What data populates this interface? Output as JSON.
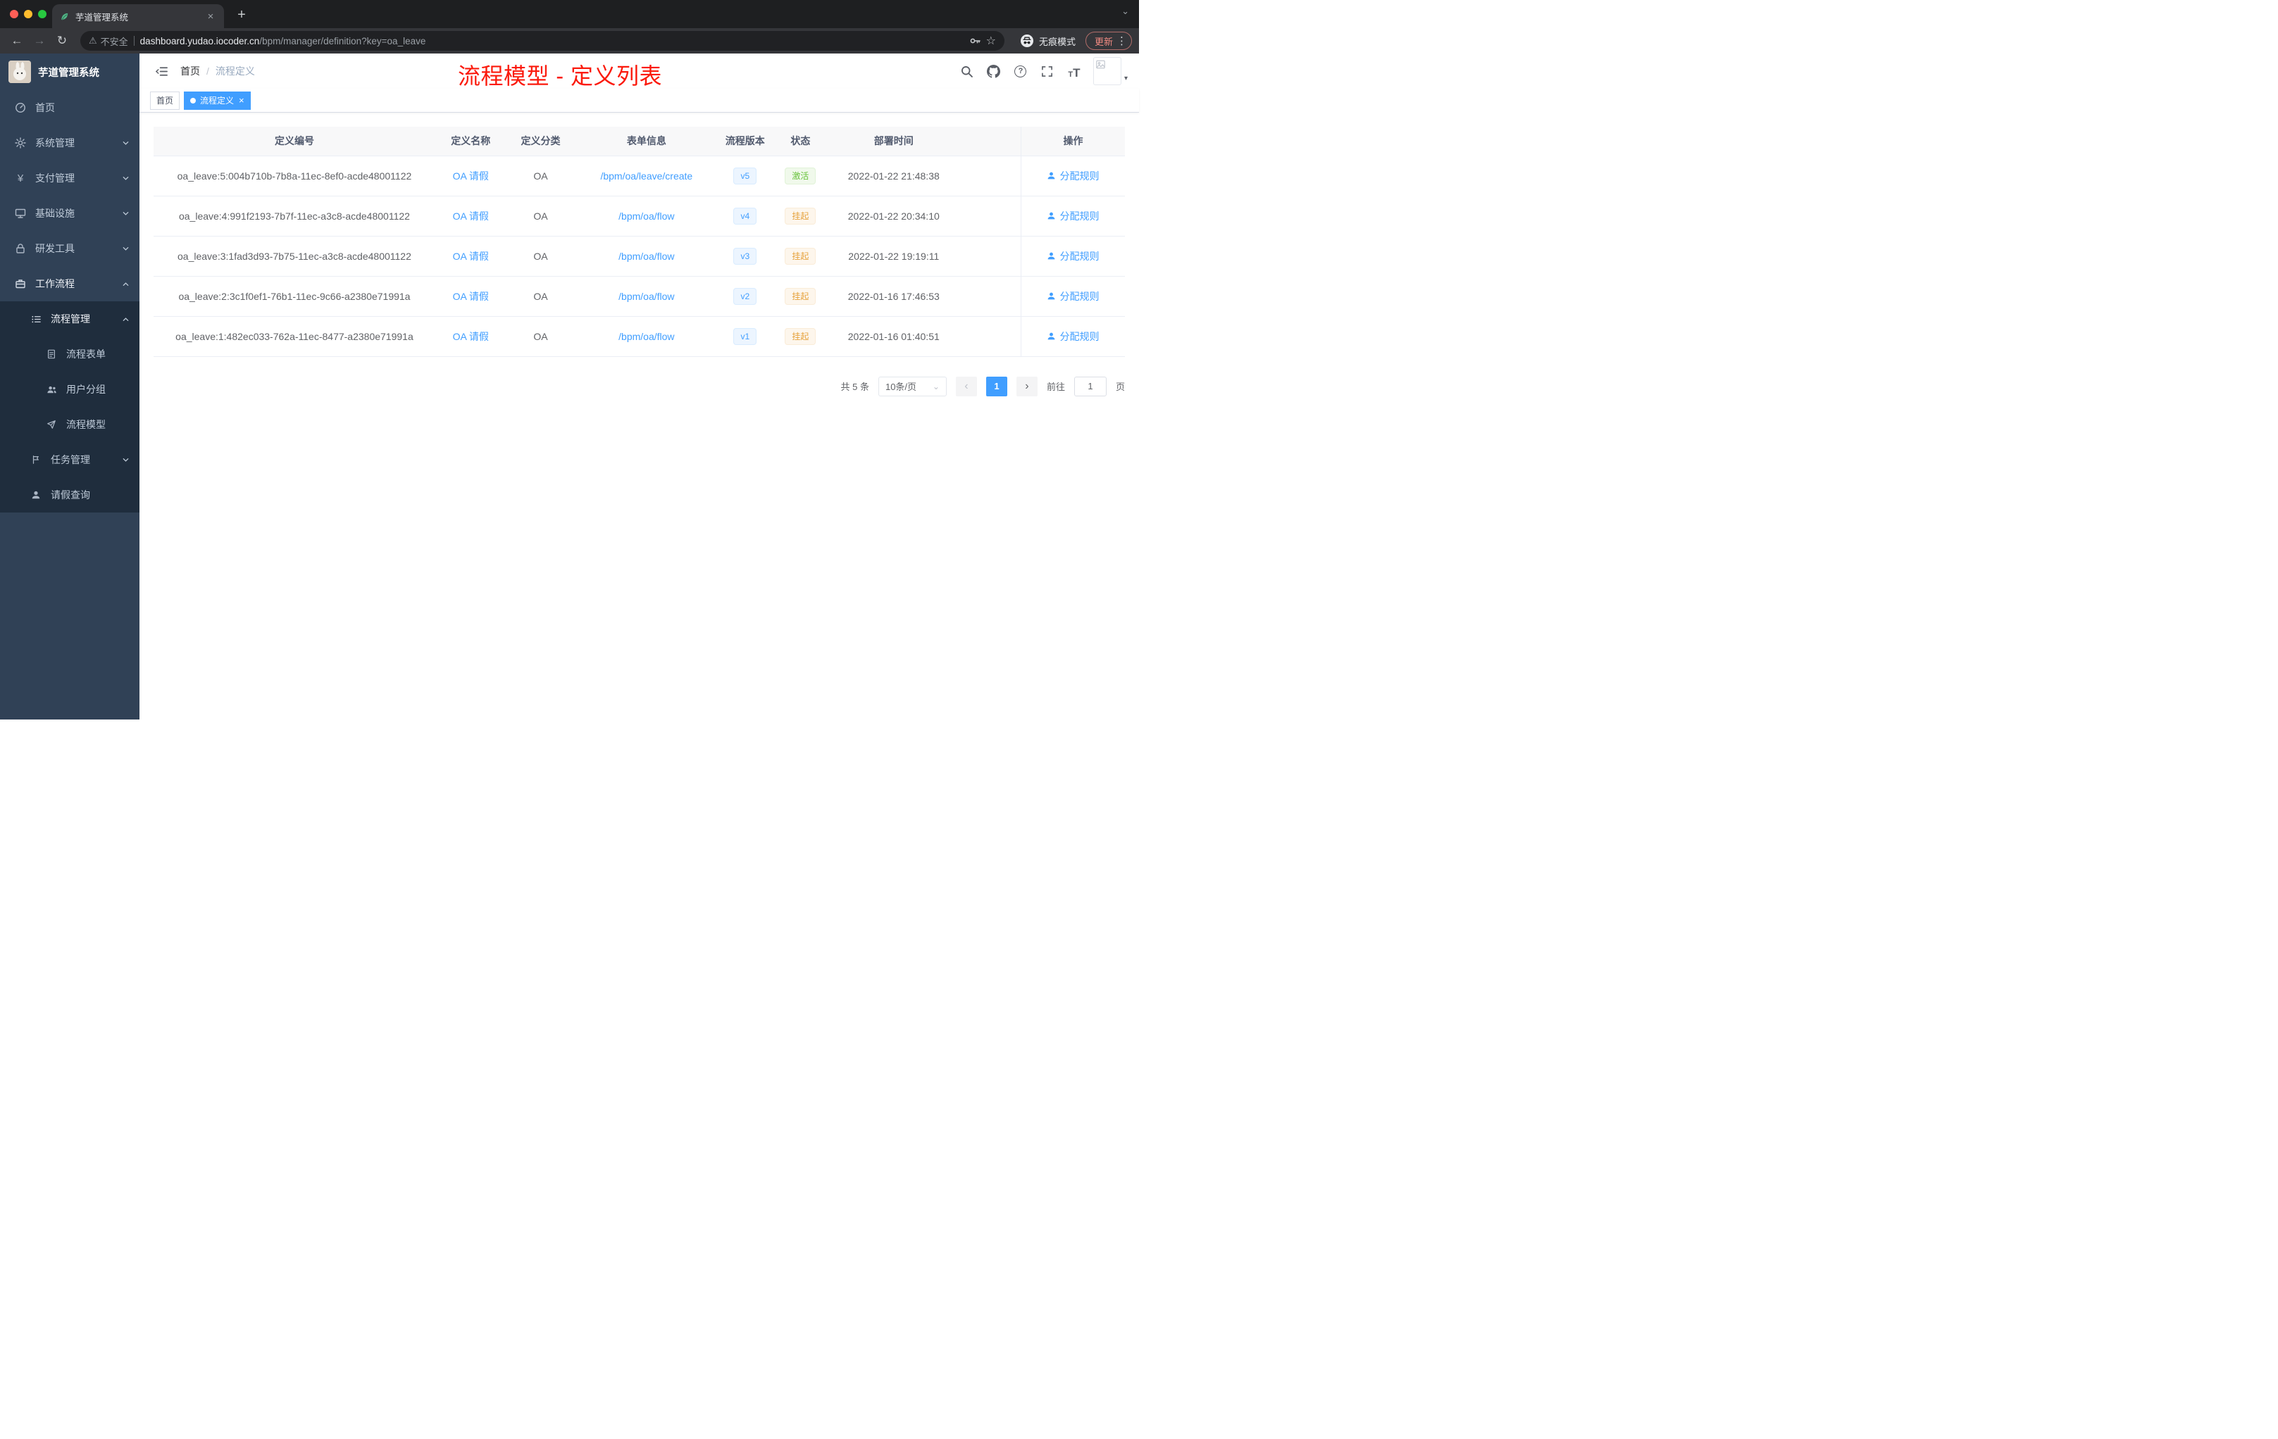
{
  "colors": {
    "accent_blue": "#409eff",
    "success_green": "#67c23a",
    "warning_orange": "#e6a23c",
    "annotation_red": "#fb1a0c",
    "sidebar_bg": "#304156",
    "submenu_bg": "#1f2d3d"
  },
  "browser": {
    "tab_title": "芋道管理系统",
    "security_label": "不安全",
    "url_host": "dashboard.yudao.iocoder.cn",
    "url_path": "/bpm/manager/definition?key=oa_leave",
    "incognito_label": "无痕模式",
    "update_label": "更新"
  },
  "icons": {
    "back": "←",
    "forward": "→",
    "reload": "↻",
    "warning": "⚠",
    "star": "☆",
    "more": "⋮",
    "new_tab": "+",
    "tab_close": "×",
    "tab_search": "⌄",
    "caret_down": "▾",
    "select_caret": "⌄",
    "prev": "‹",
    "next": "›",
    "help": "?",
    "font_t": "T"
  },
  "sidebar": {
    "logo_title": "芋道管理系统",
    "menu": [
      {
        "label": "首页"
      },
      {
        "label": "系统管理"
      },
      {
        "label": "支付管理"
      },
      {
        "label": "基础设施"
      },
      {
        "label": "研发工具"
      },
      {
        "label": "工作流程"
      },
      {
        "label": "流程管理"
      },
      {
        "label": "流程表单"
      },
      {
        "label": "用户分组"
      },
      {
        "label": "流程模型"
      },
      {
        "label": "任务管理"
      },
      {
        "label": "请假查询"
      }
    ]
  },
  "header": {
    "breadcrumb_home": "首页",
    "breadcrumb_sep": "/",
    "breadcrumb_current": "流程定义",
    "annotation": "流程模型 - 定义列表"
  },
  "tags": {
    "first": "首页",
    "active": "流程定义"
  },
  "table": {
    "headers": [
      "定义编号",
      "定义名称",
      "定义分类",
      "表单信息",
      "流程版本",
      "状态",
      "部署时间",
      "操作"
    ],
    "action_label": "分配规则",
    "rows": [
      {
        "id": "oa_leave:5:004b710b-7b8a-11ec-8ef0-acde48001122",
        "name": "OA 请假",
        "category": "OA",
        "form": "/bpm/oa/leave/create",
        "version": "v5",
        "status": "激活",
        "deploy_time": "2022-01-22 21:48:38"
      },
      {
        "id": "oa_leave:4:991f2193-7b7f-11ec-a3c8-acde48001122",
        "name": "OA 请假",
        "category": "OA",
        "form": "/bpm/oa/flow",
        "version": "v4",
        "status": "挂起",
        "deploy_time": "2022-01-22 20:34:10"
      },
      {
        "id": "oa_leave:3:1fad3d93-7b75-11ec-a3c8-acde48001122",
        "name": "OA 请假",
        "category": "OA",
        "form": "/bpm/oa/flow",
        "version": "v3",
        "status": "挂起",
        "deploy_time": "2022-01-22 19:19:11"
      },
      {
        "id": "oa_leave:2:3c1f0ef1-76b1-11ec-9c66-a2380e71991a",
        "name": "OA 请假",
        "category": "OA",
        "form": "/bpm/oa/flow",
        "version": "v2",
        "status": "挂起",
        "deploy_time": "2022-01-16 17:46:53"
      },
      {
        "id": "oa_leave:1:482ec033-762a-11ec-8477-a2380e71991a",
        "name": "OA 请假",
        "category": "OA",
        "form": "/bpm/oa/flow",
        "version": "v1",
        "status": "挂起",
        "deploy_time": "2022-01-16 01:40:51"
      }
    ]
  },
  "pagination": {
    "total": "共 5 条",
    "page_size": "10条/页",
    "current_page": "1",
    "goto_label": "前往",
    "goto_value": "1",
    "unit_label": "页"
  }
}
